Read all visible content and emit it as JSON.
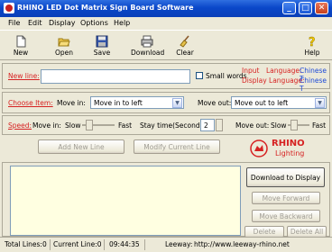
{
  "window": {
    "title": "RHINO LED Dot Matrix Sign Board Software"
  },
  "menu": [
    "File",
    "Edit",
    "Display",
    "Options",
    "Help"
  ],
  "toolbar": {
    "new": "New",
    "open": "Open",
    "save": "Save",
    "download": "Download",
    "clear": "Clear",
    "help": "Help"
  },
  "new_line": {
    "label": "New line:",
    "small_words": "Small words",
    "input_lang_label": "Input",
    "language_label": "Language:",
    "input_lang": "Chinese T",
    "display_lang_label": "Display Language:",
    "display_lang": "Chinese T"
  },
  "choose_item": {
    "label": "Choose Item:",
    "move_in_label": "Move in:",
    "move_in_value": "Move in to left",
    "move_out_label": "Move out:",
    "move_out_value": "Move out to left"
  },
  "speed": {
    "label": "Speed:",
    "move_in_label": "Move in:",
    "slow": "Slow",
    "fast": "Fast",
    "stay_label": "Stay time(Seconds):",
    "stay_value": "2",
    "move_out_label": "Move out:",
    "slow2": "Slow",
    "fast2": "Fast"
  },
  "buttons": {
    "add_new_line": "Add New Line",
    "modify_line": "Modify Current Line",
    "download_display": "Download to Display",
    "move_forward": "Move Forward",
    "move_backward": "Move Backward",
    "delete_one": "Delete One",
    "delete_all": "Delete All"
  },
  "logo": {
    "name": "RHINO",
    "sub": "Lighting"
  },
  "status": {
    "total_lines": "Total Lines:0",
    "current_line": "Current Line:0",
    "time": "09:44:35",
    "leeway": "Leeway:",
    "url": "http://www.leeway-rhino.net"
  },
  "colors": {
    "title_bar": "#0a47c9",
    "label_red": "#d62222",
    "label_blue": "#1e4bd8",
    "panel": "#ECE9D8",
    "list_bg": "#FFFFE1"
  }
}
